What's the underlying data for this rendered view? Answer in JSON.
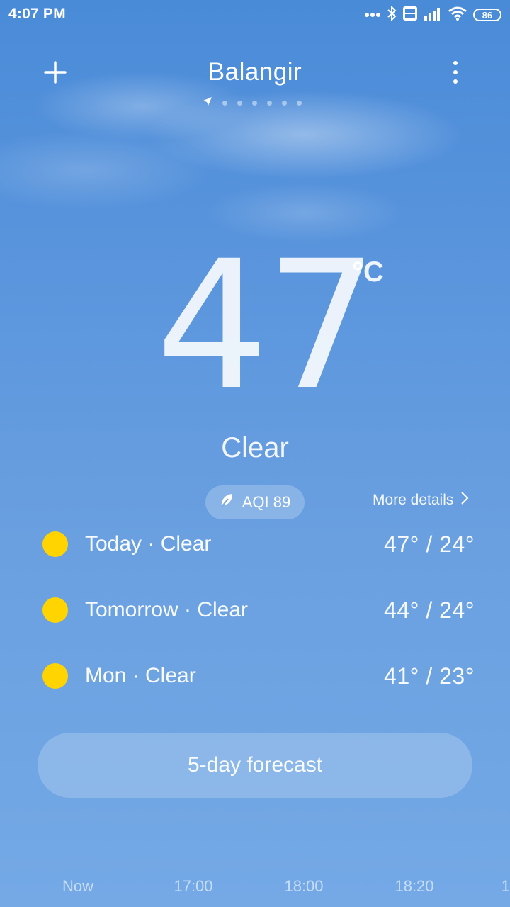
{
  "status_bar": {
    "time": "4:07 PM",
    "battery": "86",
    "icons": [
      "dots-icon",
      "bluetooth-icon",
      "volte-icon",
      "signal-icon",
      "wifi-icon",
      "battery-icon"
    ]
  },
  "header": {
    "city": "Balangir",
    "page_count": 7,
    "current_page": 0
  },
  "current": {
    "temperature": "47",
    "unit": "°C",
    "condition": "Clear"
  },
  "aqi": {
    "label": "AQI 89",
    "icon": "leaf-icon"
  },
  "more_details": "More details",
  "forecast": [
    {
      "label": "Today · Clear",
      "temps": "47° / 24°",
      "icon": "sun-icon"
    },
    {
      "label": "Tomorrow · Clear",
      "temps": "44° / 24°",
      "icon": "sun-icon"
    },
    {
      "label": "Mon · Clear",
      "temps": "41° / 23°",
      "icon": "sun-icon"
    }
  ],
  "five_day_button": "5-day forecast",
  "hourly": [
    "Now",
    "17:00",
    "18:00",
    "18:20",
    "1"
  ],
  "colors": {
    "sun": "#ffd400",
    "sky_top": "#4a8bd8",
    "sky_bottom": "#74a9e6"
  }
}
